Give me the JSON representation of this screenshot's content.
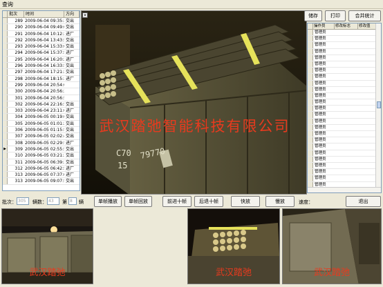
{
  "window": {
    "title": "查询"
  },
  "left_table": {
    "headers": [
      "批次",
      "时间",
      "方向"
    ],
    "selected_index": 20,
    "rows": [
      {
        "id": "289",
        "time": "2009-06-04 09:35:36",
        "dir": "交出"
      },
      {
        "id": "290",
        "time": "2009-06-04 09:49:06",
        "dir": "交出"
      },
      {
        "id": "291",
        "time": "2009-06-04 10:12:27",
        "dir": "进厂"
      },
      {
        "id": "292",
        "time": "2009-06-04 13:43:54",
        "dir": "交出"
      },
      {
        "id": "293",
        "time": "2009-06-04 15:33:09",
        "dir": "交出"
      },
      {
        "id": "294",
        "time": "2009-06-04 15:37:58",
        "dir": "进厂"
      },
      {
        "id": "295",
        "time": "2009-06-04 16:20:25",
        "dir": "进厂"
      },
      {
        "id": "296",
        "time": "2009-06-04 16:33:51",
        "dir": "交出"
      },
      {
        "id": "297",
        "time": "2009-06-04 17:21:28",
        "dir": "交出"
      },
      {
        "id": "298",
        "time": "2009-06-04 18:15:34",
        "dir": "进厂"
      },
      {
        "id": "299",
        "time": "2009-06-04 20:54:02",
        "dir": ""
      },
      {
        "id": "300",
        "time": "2009-06-04 20:56:30",
        "dir": ""
      },
      {
        "id": "301",
        "time": "2009-06-04 20:56:57",
        "dir": ""
      },
      {
        "id": "302",
        "time": "2009-06-04 22:16:58",
        "dir": "交出"
      },
      {
        "id": "303",
        "time": "2009-06-04 23:11:06",
        "dir": "进厂"
      },
      {
        "id": "304",
        "time": "2009-06-05 00:19:03",
        "dir": "交出"
      },
      {
        "id": "305",
        "time": "2009-06-05 01:01:28",
        "dir": "交出"
      },
      {
        "id": "306",
        "time": "2009-06-05 01:15:51",
        "dir": "交出"
      },
      {
        "id": "307",
        "time": "2009-06-05 02:02:40",
        "dir": "交出"
      },
      {
        "id": "308",
        "time": "2009-06-05 02:29:51",
        "dir": "进厂"
      },
      {
        "id": "309",
        "time": "2009-06-05 02:55:51",
        "dir": "交出"
      },
      {
        "id": "310",
        "time": "2009-06-05 03:21:31",
        "dir": "交出"
      },
      {
        "id": "311",
        "time": "2009-06-05 06:39:30",
        "dir": "交出"
      },
      {
        "id": "312",
        "time": "2009-06-05 06:42:59",
        "dir": "进厂"
      },
      {
        "id": "313",
        "time": "2009-06-05 07:37:08",
        "dir": "进厂"
      },
      {
        "id": "313",
        "time": "2009-06-05 09:07:51",
        "dir": "交出"
      }
    ]
  },
  "main_video": {
    "overlay_text": "武汉踏弛智能科技有限公司",
    "car_marking_line1": "C70",
    "car_marking_line2": "15",
    "car_marking_number": "79770",
    "close_glyph": "×"
  },
  "right_buttons": {
    "save": "储存",
    "print": "打印",
    "merge_stat": "合并统计"
  },
  "right_table": {
    "headers": [
      "操作员",
      "修改标志",
      "修改值"
    ],
    "operator": "管理员",
    "row_count": 25
  },
  "controls": {
    "batch_label": "批次：",
    "batch_value": "305",
    "count_label": "辆数：",
    "count_value": "43",
    "nth_label": "第",
    "nth_value": "8",
    "unit_label": "辆",
    "speed_label": "速度：",
    "buttons": {
      "single_play": "单帧播放",
      "single_back": "单帧回放",
      "forward10": "前进十帧",
      "back10": "后退十帧",
      "fast": "快放",
      "slow": "慢放",
      "exit": "退出"
    }
  },
  "thumbnails": [
    {
      "overlay": "武汉踏弛"
    },
    {
      "overlay": "武汉踏弛"
    },
    {
      "overlay": "武汉踏弛"
    }
  ],
  "colors": {
    "overlay_red": "#e83a1e",
    "window_bg": "#ece9d8"
  }
}
